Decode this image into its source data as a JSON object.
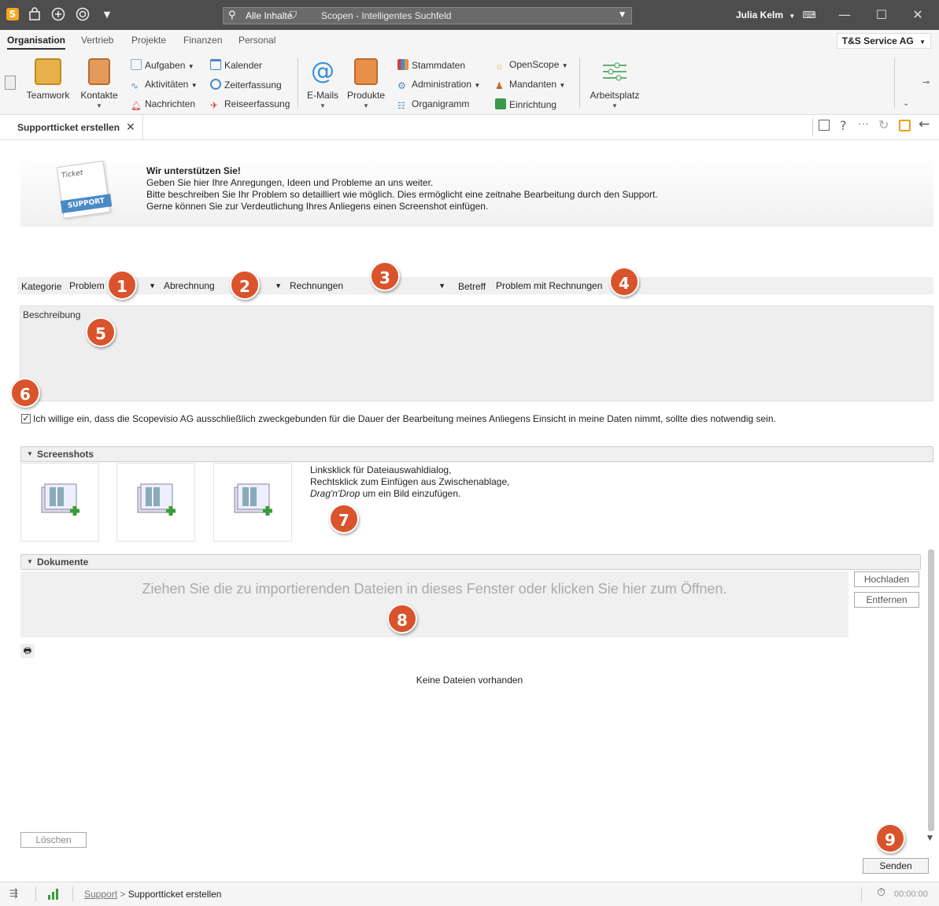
{
  "titlebar": {
    "scope": "Alle Inhalte",
    "search_placeholder": "Scopen - Intelligentes Suchfeld",
    "user": "Julia Kelm"
  },
  "ribbon_tabs": [
    "Organisation",
    "Vertrieb",
    "Projekte",
    "Finanzen",
    "Personal"
  ],
  "company": "T&S Service AG",
  "ribbon": {
    "teamwork": "Teamwork",
    "kontakte": "Kontakte",
    "aufgaben": "Aufgaben",
    "aktivitaeten": "Aktivitäten",
    "nachrichten": "Nachrichten",
    "kalender": "Kalender",
    "zeiterfassung": "Zeiterfassung",
    "reiseerfassung": "Reiseerfassung",
    "emails": "E-Mails",
    "produkte": "Produkte",
    "stammdaten": "Stammdaten",
    "administration": "Administration",
    "organigramm": "Organigramm",
    "openscope": "OpenScope",
    "mandanten": "Mandanten",
    "einrichtung": "Einrichtung",
    "arbeitsplatz": "Arbeitsplatz"
  },
  "doc_tab": "Supportticket erstellen",
  "banner": {
    "image_text_1": "Ticket",
    "image_text_2": "SUPPORT",
    "headline": "Wir unterstützen Sie!",
    "line1": "Geben Sie hier Ihre Anregungen, Ideen und Probleme an uns weiter.",
    "line2": "Bitte beschreiben Sie Ihr Problem so detailliert wie möglich. Dies ermöglicht eine zeitnahe Bearbeitung durch den Support.",
    "line3": "Gerne können Sie zur Verdeutlichung Ihres Anliegens einen Screenshot einfügen."
  },
  "form": {
    "kategorie_label": "Kategorie",
    "kategorie_value": "Problem",
    "sub1_value": "Abrechnung",
    "sub2_value": "Rechnungen",
    "betreff_label": "Betreff",
    "betreff_value": "Problem mit Rechnungen",
    "beschreibung_placeholder": "Beschreibung",
    "consent": "Ich willige ein, dass die Scopevisio AG ausschließlich zweckgebunden für die Dauer der Bearbeitung meines Anliegens Einsicht in meine Daten nimmt, sollte dies notwendig sein.",
    "consent_checked": true
  },
  "screenshots": {
    "title": "Screenshots",
    "hint1": "Linksklick für Dateiauswahldialog,",
    "hint2": "Rechtsklick zum Einfügen aus Zwischenablage,",
    "hint3_em": "Drag'n'Drop",
    "hint3_rest": " um ein Bild einzufügen."
  },
  "dokumente": {
    "title": "Dokumente",
    "dropzone": "Ziehen Sie die zu importierenden Dateien in dieses Fenster oder klicken Sie hier zum Öffnen.",
    "upload": "Hochladen",
    "remove": "Entfernen",
    "empty": "Keine Dateien vorhanden"
  },
  "buttons": {
    "delete": "Löschen",
    "send": "Senden"
  },
  "markers": [
    "1",
    "2",
    "3",
    "4",
    "5",
    "6",
    "7",
    "8",
    "9"
  ],
  "statusbar": {
    "crumb_link": "Support",
    "crumb_sep": ">",
    "crumb_current": "Supportticket erstellen",
    "timer": "00:00:00"
  },
  "colors": {
    "titlebar": "#4d4d4d",
    "marker": "#d9532c",
    "accent": "#f5a623"
  }
}
